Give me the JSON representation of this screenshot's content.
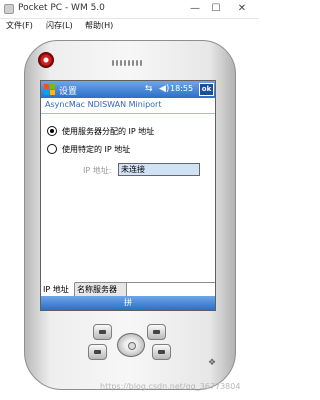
{
  "window": {
    "title": "Pocket PC - WM 5.0",
    "minimize": "—",
    "maximize": "☐",
    "close": "✕"
  },
  "menubar": {
    "items": [
      "文件(F)",
      "闪存(L)",
      "帮助(H)"
    ]
  },
  "device": {
    "statusbar": {
      "title": "设置",
      "signal": "⇆",
      "volume": "◀)",
      "time": "18:55",
      "ok_label": "ok",
      "logo_colors": [
        "#f25022",
        "#7fba00",
        "#00a4ef",
        "#ffb900"
      ]
    },
    "subtitle": "AsyncMac NDISWAN Miniport",
    "options": [
      {
        "label": "使用服务器分配的 IP 地址",
        "selected": true
      },
      {
        "label": "使用特定的 IP 地址",
        "selected": false
      }
    ],
    "ip_label": "IP 地址:",
    "ip_value": "未连接",
    "tabs": [
      {
        "label": "IP 地址",
        "active": true
      },
      {
        "label": "名称服务器",
        "active": false
      }
    ],
    "softkey": "拼"
  },
  "watermark": "https://blog.csdn.net/qq_36773804"
}
